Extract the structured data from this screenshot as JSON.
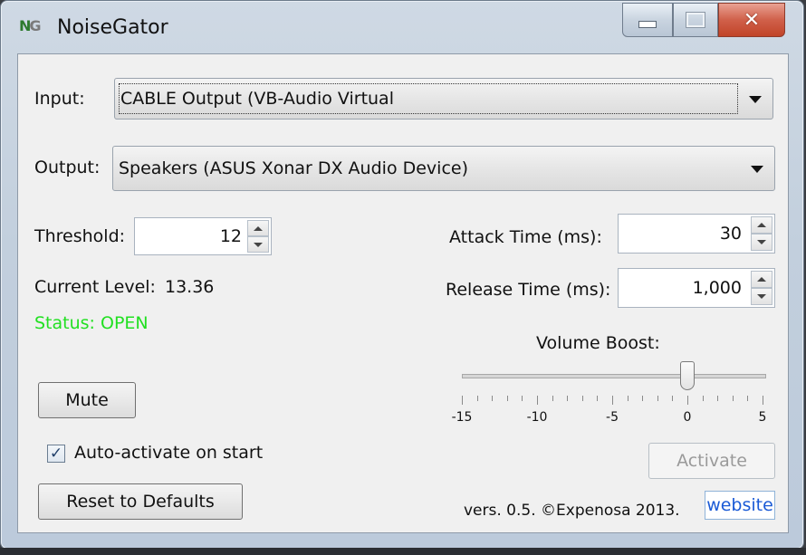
{
  "window": {
    "title": "NoiseGator",
    "icon": "NG",
    "icon_name": "noisegator-logo-icon",
    "controls": {
      "minimize": "minimize",
      "maximize": "maximize",
      "close": "close"
    },
    "close_color": "#c14428"
  },
  "input": {
    "label": "Input:",
    "value": "CABLE Output (VB-Audio Virtual"
  },
  "output": {
    "label": "Output:",
    "value": "Speakers (ASUS Xonar DX Audio Device)"
  },
  "threshold": {
    "label": "Threshold:",
    "value": "12"
  },
  "current_level": {
    "label": "Current Level:",
    "value": "13.36"
  },
  "status": {
    "text": "Status: OPEN",
    "color": "#22e022"
  },
  "attack": {
    "label": "Attack Time (ms):",
    "value": "30"
  },
  "release": {
    "label": "Release Time (ms):",
    "value": "1,000"
  },
  "volume_boost": {
    "label": "Volume Boost:",
    "min": -15,
    "max": 5,
    "value": 0,
    "tick_labels": [
      "-15",
      "-10",
      "-5",
      "0",
      "5"
    ]
  },
  "buttons": {
    "mute": "Mute",
    "reset": "Reset to Defaults",
    "activate": "Activate",
    "website": "website"
  },
  "auto_activate": {
    "label": "Auto-activate on start",
    "checked": true,
    "mark": "✓"
  },
  "footer": {
    "version": "vers. 0.5. ©Expenosa 2013."
  }
}
